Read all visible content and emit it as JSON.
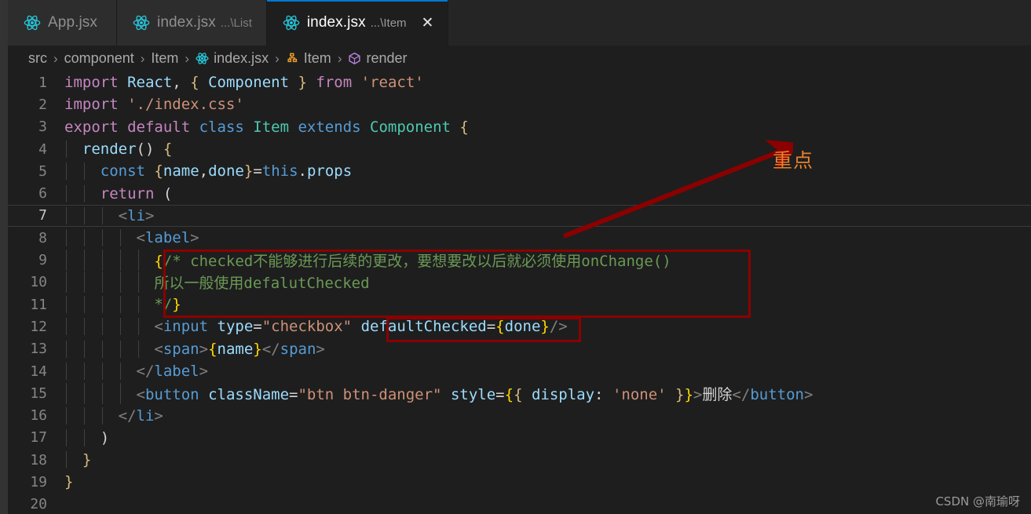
{
  "window": {
    "theme_bg": "#1e1e1e",
    "accent": "#0078d4"
  },
  "tabs": [
    {
      "name": "App.jsx",
      "desc": "",
      "icon": "react-icon",
      "active": false,
      "closable": false
    },
    {
      "name": "index.jsx",
      "desc": "...\\List",
      "icon": "react-icon",
      "active": false,
      "closable": false
    },
    {
      "name": "index.jsx",
      "desc": "...\\Item",
      "icon": "react-icon",
      "active": true,
      "closable": true,
      "close_label": "✕"
    }
  ],
  "breadcrumb": {
    "items": [
      {
        "label": "src",
        "icon": ""
      },
      {
        "label": "component",
        "icon": ""
      },
      {
        "label": "Item",
        "icon": ""
      },
      {
        "label": "index.jsx",
        "icon": "react-icon"
      },
      {
        "label": "Item",
        "icon": "class-symbol-icon"
      },
      {
        "label": "render",
        "icon": "method-symbol-icon"
      }
    ],
    "separator": "›"
  },
  "editor": {
    "language": "javascriptreact",
    "current_line": 7,
    "lines": [
      {
        "n": "1",
        "text": "import React, { Component } from 'react'"
      },
      {
        "n": "2",
        "text": "import './index.css'"
      },
      {
        "n": "3",
        "text": "export default class Item extends Component {"
      },
      {
        "n": "4",
        "text": "  render() {"
      },
      {
        "n": "5",
        "text": "    const {name,done}=this.props"
      },
      {
        "n": "6",
        "text": "    return ("
      },
      {
        "n": "7",
        "text": "      <li>"
      },
      {
        "n": "8",
        "text": "        <label>"
      },
      {
        "n": "9",
        "text": "          {/* checked不能够进行后续的更改，要想要改以后就必须使用onChange()"
      },
      {
        "n": "10",
        "text": "          所以一般使用defalutChecked"
      },
      {
        "n": "11",
        "text": "          */}"
      },
      {
        "n": "12",
        "text": "          <input type=\"checkbox\" defaultChecked={done}/>"
      },
      {
        "n": "13",
        "text": "          <span>{name}</span>"
      },
      {
        "n": "14",
        "text": "        </label>"
      },
      {
        "n": "15",
        "text": "        <button className=\"btn btn-danger\" style={{ display: 'none' }}>删除</button>"
      },
      {
        "n": "16",
        "text": "      </li>"
      },
      {
        "n": "17",
        "text": "    )"
      },
      {
        "n": "18",
        "text": "  }"
      },
      {
        "n": "19",
        "text": "}"
      },
      {
        "n": "20",
        "text": ""
      }
    ]
  },
  "annotations": {
    "label": "重点",
    "label_color": "#E8812B",
    "box_color": "#8B0000",
    "arrow_color": "#8B0000",
    "boxes": [
      {
        "target": "jsx-comment-block",
        "lines": "9-11"
      },
      {
        "target": "defaultChecked-attribute",
        "lines": "12"
      }
    ]
  },
  "watermark": {
    "text": "CSDN @南瑜呀"
  }
}
